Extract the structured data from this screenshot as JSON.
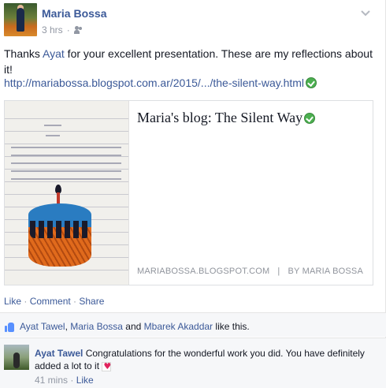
{
  "post": {
    "author": "Maria Bossa",
    "time": "3 hrs",
    "audience_icon": "friends-icon",
    "text_before": "Thanks ",
    "mention": "Ayat",
    "text_after": " for your excellent presentation. These are my reflections about it!",
    "link_url": "http://mariabossa.blogspot.com.ar/2015/.../the-silent-way.html",
    "link_icon": "verified-check-icon"
  },
  "card": {
    "title": "Maria's blog: The Silent Way",
    "domain": "MARIABOSSA.BLOGSPOT.COM",
    "separator": "|",
    "byline": "BY MARIA BOSSA"
  },
  "actions": {
    "like": "Like",
    "comment": "Comment",
    "share": "Share",
    "dot": " · "
  },
  "likes": {
    "name1": "Ayat Tawel",
    "comma": ", ",
    "name2": "Maria Bossa",
    "and": " and ",
    "name3": "Mbarek Akaddar",
    "suffix": " like this."
  },
  "comment": {
    "author": "Ayat Tawel",
    "text": " Congratulations for the wonderful work you did. You have definitely added a lot to it ",
    "emoji_icon": "heart-icon",
    "time": "41 mins",
    "like": "Like",
    "dot": " · "
  },
  "colors": {
    "link": "#3b5998",
    "meta": "#9197a3",
    "like_bar": "#f6f7f9"
  }
}
